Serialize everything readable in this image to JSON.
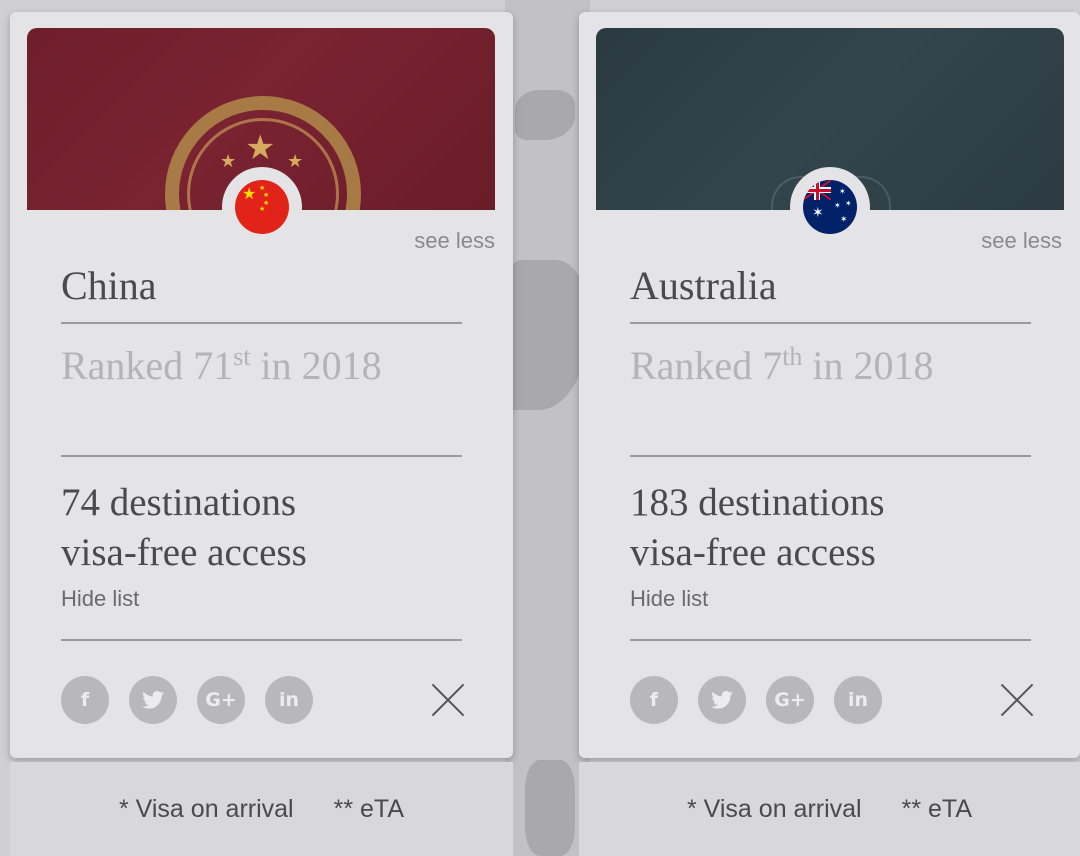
{
  "cards": [
    {
      "country": "China",
      "see_less": "see less",
      "rank_prefix": "Ranked 71",
      "rank_suffix": "st",
      "rank_year": " in 2018",
      "destinations_line1": "74 destinations",
      "destinations_line2": "visa-free access",
      "hide_list": "Hide list",
      "legend_visa_on_arrival": "* Visa on arrival",
      "legend_eta": "** eTA",
      "cover_color": "#6e1e2a",
      "flag": "china-flag-icon"
    },
    {
      "country": "Australia",
      "see_less": "see less",
      "rank_prefix": "Ranked 7",
      "rank_suffix": "th",
      "rank_year": " in 2018",
      "destinations_line1": "183 destinations",
      "destinations_line2": "visa-free access",
      "hide_list": "Hide list",
      "legend_visa_on_arrival": "* Visa on arrival",
      "legend_eta": "** eTA",
      "cover_color": "#2a3a40",
      "flag": "australia-flag-icon"
    }
  ],
  "social": {
    "facebook": "f",
    "twitter": "🐦",
    "googleplus": "G+",
    "linkedin": "in"
  }
}
